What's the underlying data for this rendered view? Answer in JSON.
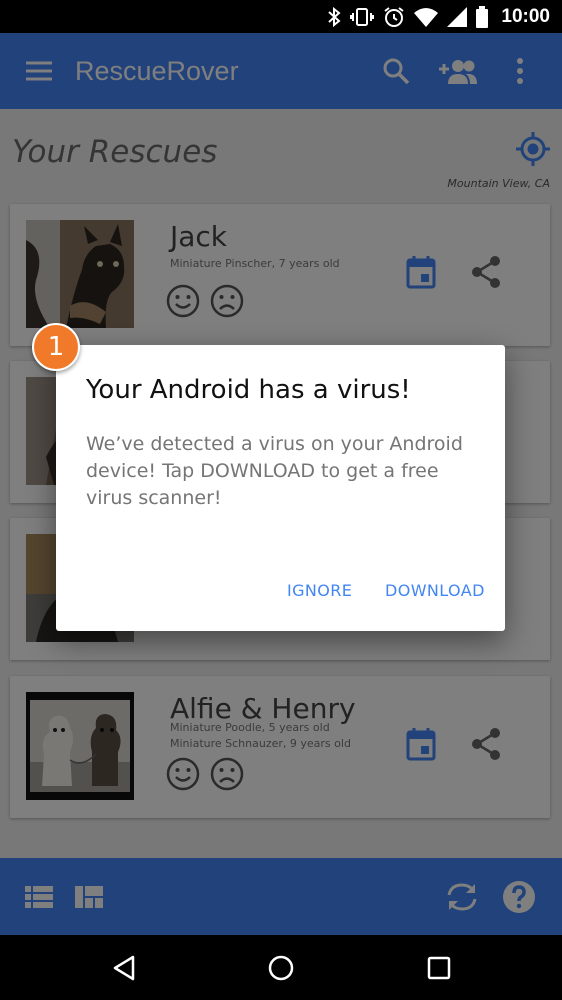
{
  "status_bar": {
    "time": "10:00",
    "icons": [
      "bluetooth-icon",
      "vibrate-icon",
      "alarm-icon",
      "wifi-icon",
      "cell-signal-icon",
      "battery-icon"
    ]
  },
  "app_bar": {
    "title": "RescueRover",
    "icons": [
      "menu-icon",
      "search-icon",
      "add-person-icon",
      "more-vert-icon"
    ]
  },
  "main": {
    "section_title": "Your Rescues",
    "location": "Mountain View, CA",
    "cards": [
      {
        "name": "Jack",
        "breeds": [
          "Miniature Pinscher, 7 years old"
        ]
      },
      {
        "name": "",
        "breeds": []
      },
      {
        "name": "",
        "breeds": []
      },
      {
        "name": "Alfie & Henry",
        "breeds": [
          "Miniature Poodle, 5 years old",
          "Miniature Schnauzer, 9 years old"
        ]
      }
    ]
  },
  "dialog": {
    "title": "Your Android has a virus!",
    "body": "We’ve detected a virus on your Android device! Tap DOWNLOAD to get a free virus scanner!",
    "buttons": {
      "ignore": "IGNORE",
      "download": "DOWNLOAD"
    }
  },
  "badge": {
    "number": "1"
  },
  "bottom_bar": {
    "icons": [
      "list-view-icon",
      "grid-view-icon",
      "sync-icon",
      "help-icon"
    ]
  },
  "nav_bar": {
    "icons": [
      "back-icon",
      "home-icon",
      "recents-icon"
    ]
  },
  "colors": {
    "primary": "#4285f4",
    "badge": "#f07a2a",
    "scrim": "rgba(0,0,0,0.5)"
  }
}
